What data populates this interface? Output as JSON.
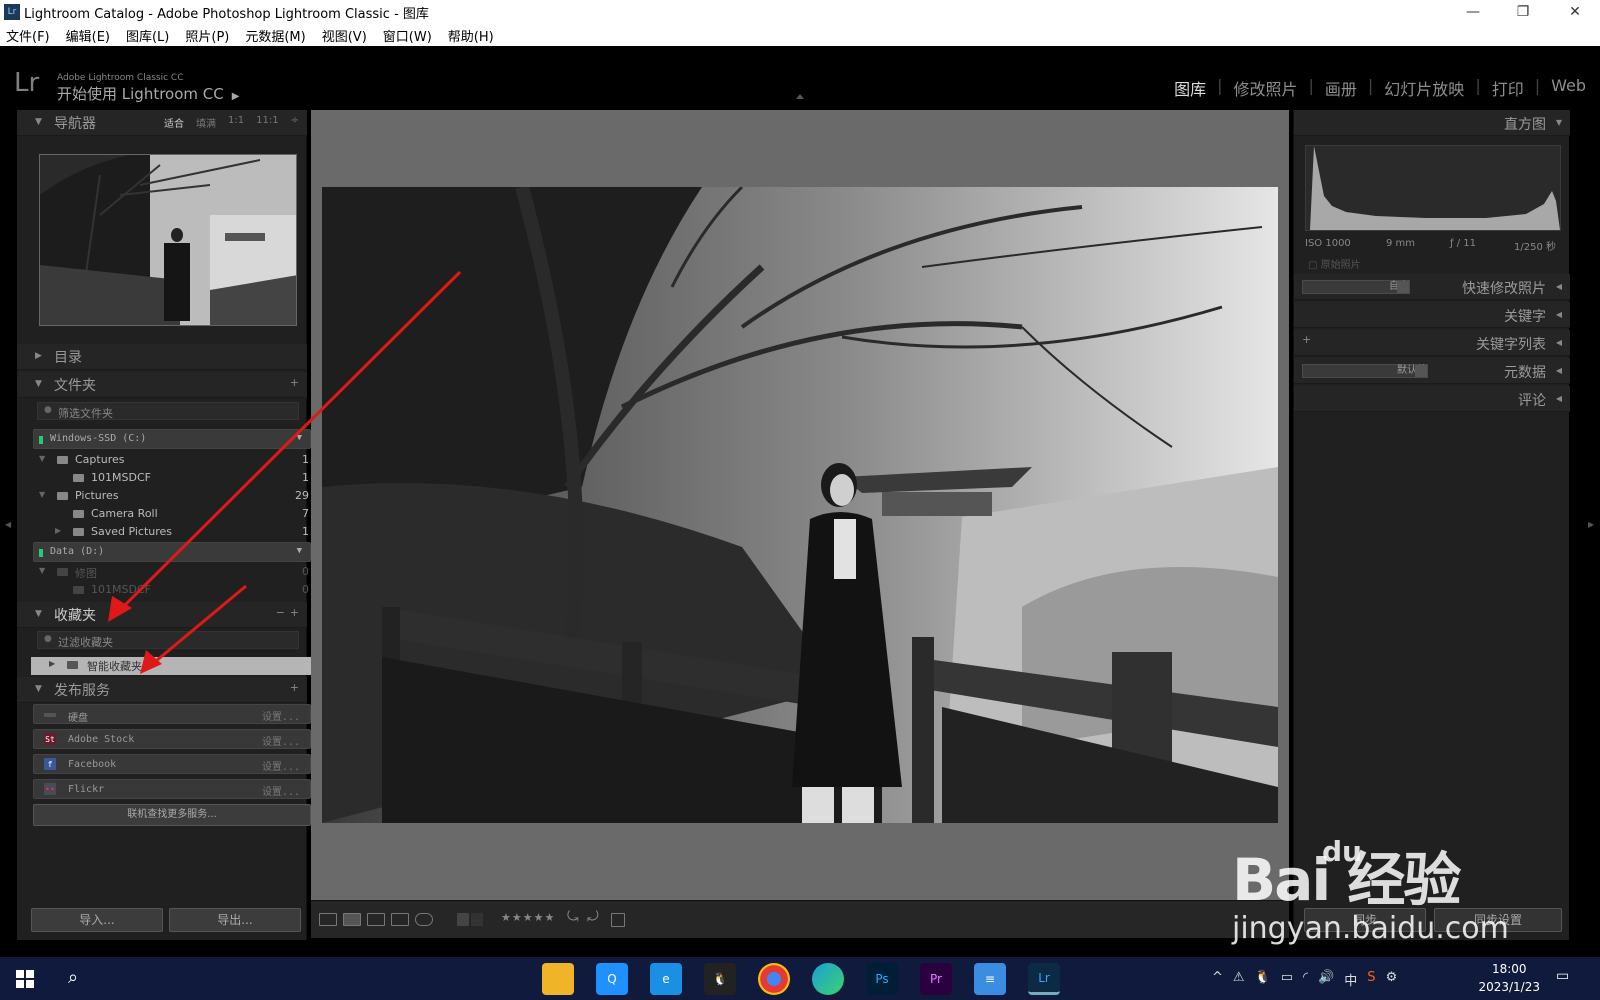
{
  "window": {
    "title": "Lightroom Catalog - Adobe Photoshop Lightroom Classic - 图库",
    "app_icon": "Lr",
    "controls": [
      "—",
      "❐",
      "✕"
    ]
  },
  "menu": [
    "文件(F)",
    "编辑(E)",
    "图库(L)",
    "照片(P)",
    "元数据(M)",
    "视图(V)",
    "窗口(W)",
    "帮助(H)"
  ],
  "header": {
    "logo": "Lr",
    "sub_small": "Adobe Lightroom Classic CC",
    "sub_big": "开始使用 Lightroom CC",
    "play": "▶",
    "modules": [
      "图库",
      "修改照片",
      "画册",
      "幻灯片放映",
      "打印",
      "Web"
    ],
    "active_module": "图库"
  },
  "navigator": {
    "title": "导航器",
    "zoom_options": [
      "适合",
      "填满",
      "1:1",
      "11:1"
    ],
    "zoom_selected": "适合",
    "zoom_caret": "÷"
  },
  "catalog": {
    "title": "目录"
  },
  "folders": {
    "title": "文件夹",
    "plus": "+",
    "filter_placeholder": "筛选文件夹",
    "volumes": [
      {
        "name": "Windows-SSD (C:)",
        "caret": "▼"
      },
      {
        "name": "Data (D:)",
        "caret": "▼"
      }
    ],
    "items": [
      {
        "name": "Captures",
        "count": "1"
      },
      {
        "name": "101MSDCF",
        "count": "1"
      },
      {
        "name": "Pictures",
        "count": "29"
      },
      {
        "name": "Camera Roll",
        "count": "7"
      },
      {
        "name": "Saved Pictures",
        "count": "1"
      },
      {
        "name": "修图",
        "count": "0"
      },
      {
        "name": "101MSDCF",
        "count": "0"
      }
    ]
  },
  "collections": {
    "title": "收藏夹",
    "minus": "−",
    "plus": "+",
    "filter_placeholder": "过滤收藏夹",
    "smart_label": "智能收藏夹"
  },
  "publish": {
    "title": "发布服务",
    "plus": "+",
    "services": [
      {
        "name": "硬盘",
        "setup": "设置...",
        "icon": "hdd-icon",
        "color": "#555555",
        "glyph": ""
      },
      {
        "name": "Adobe Stock",
        "setup": "设置...",
        "icon": "adobe-stock-icon",
        "color": "#6a1a2a",
        "glyph": "St"
      },
      {
        "name": "Facebook",
        "setup": "设置...",
        "icon": "facebook-icon",
        "color": "#3b5998",
        "glyph": "f"
      },
      {
        "name": "Flickr",
        "setup": "设置...",
        "icon": "flickr-icon",
        "color": "#4a4a5a",
        "glyph": "••"
      }
    ],
    "find_more": "联机查找更多服务..."
  },
  "import_label": "导入...",
  "export_label": "导出...",
  "toolbar": {
    "stars": "★★★★★",
    "rotate_left": "⤿",
    "rotate_right": "⤾"
  },
  "histogram": {
    "title": "直方图",
    "iso": "ISO 1000",
    "focal": "9 mm",
    "aperture": "ƒ / 11",
    "shutter": "1/250 秒",
    "original": "原始照片"
  },
  "right_panels": {
    "quick_develop": "快速修改照片",
    "quick_preset": "自定",
    "keywords": "关键字",
    "keyword_list": "关键字列表",
    "keyword_plus": "+",
    "metadata": "元数据",
    "metadata_preset": "默认值",
    "comments": "评论"
  },
  "right_buttons": {
    "sync_metadata": "同步",
    "sync_settings": "同步设置"
  },
  "taskbar": {
    "apps": [
      {
        "name": "file-explorer-icon",
        "color": "#f0b429",
        "glyph": ""
      },
      {
        "name": "browser-q-icon",
        "color": "#1e90ff",
        "glyph": "Q"
      },
      {
        "name": "edge-legacy-icon",
        "color": "#1a8fe3",
        "glyph": "e"
      },
      {
        "name": "qq-icon",
        "color": "#222",
        "glyph": "🐧"
      },
      {
        "name": "chrome-icon",
        "color": "#e53935",
        "glyph": ""
      },
      {
        "name": "edge-icon",
        "color": "#1aa0d8",
        "glyph": ""
      },
      {
        "name": "photoshop-icon",
        "color": "#001e36",
        "glyph": "Ps"
      },
      {
        "name": "premiere-icon",
        "color": "#2a003f",
        "glyph": "Pr"
      },
      {
        "name": "notepad-icon",
        "color": "#3a8de0",
        "glyph": "≡"
      },
      {
        "name": "lightroom-icon",
        "color": "#0c2a44",
        "glyph": "Lr"
      }
    ],
    "tray": [
      "^",
      "⚠",
      "🐧",
      "▭",
      "◜",
      "🔊",
      "中",
      "S",
      "⚙"
    ],
    "time": "18:00",
    "date": "2023/1/23",
    "notification": "▭"
  },
  "watermark": {
    "big": "Bai 经验",
    "paw": "du",
    "small": "jingyan.baidu.com"
  }
}
